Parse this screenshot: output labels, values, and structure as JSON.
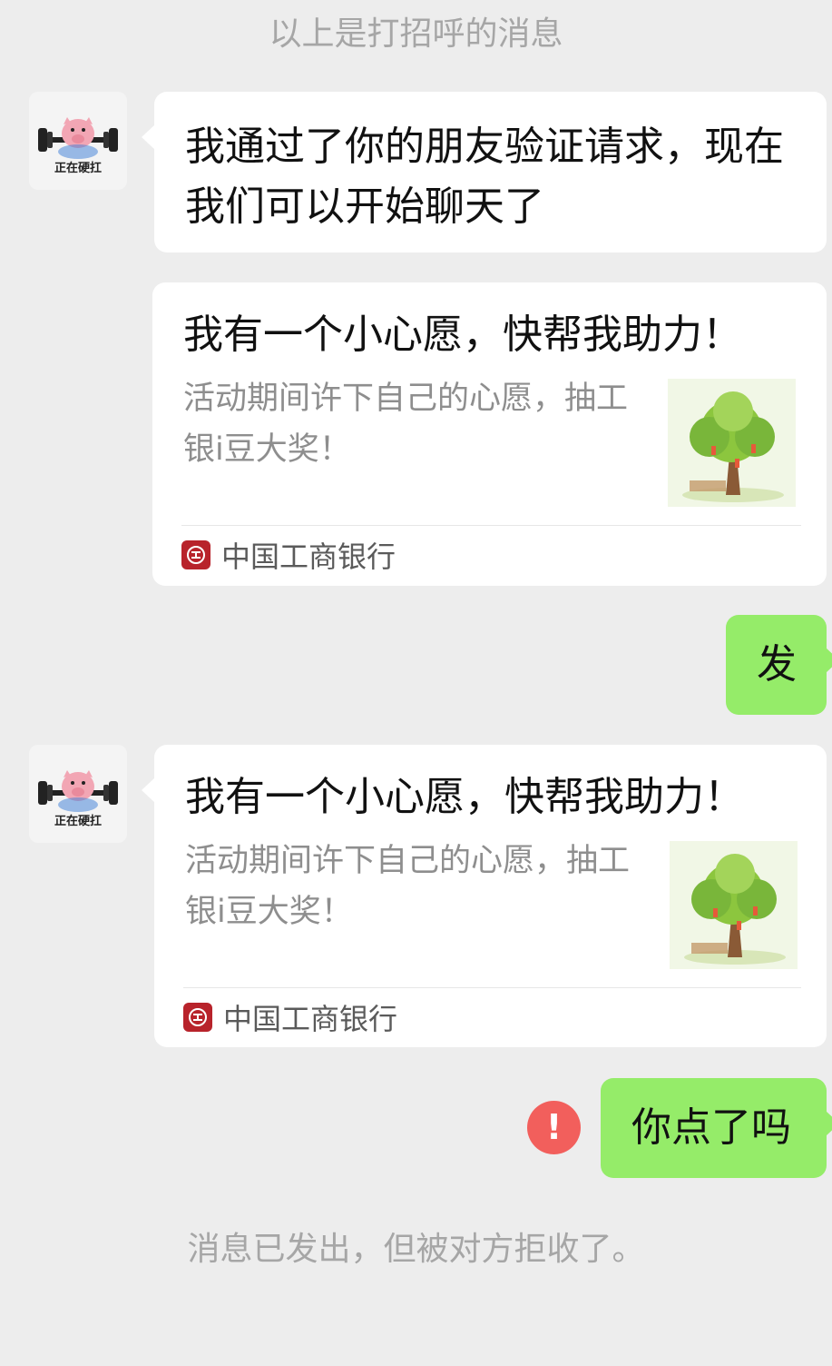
{
  "system": {
    "greeting_notice": "以上是打招呼的消息",
    "rejected_notice": "消息已发出，但被对方拒收了。"
  },
  "contact": {
    "avatar_label": "正在硬扛",
    "avatar_icon": "pig-lifting-barbell-icon"
  },
  "messages": [
    {
      "direction": "in",
      "type": "text",
      "text": "我通过了你的朋友验证请求，现在我们可以开始聊天了"
    },
    {
      "direction": "in",
      "type": "card",
      "title": "我有一个小心愿，快帮我助力！",
      "description": "活动期间许下自己的心愿，抽工银i豆大奖！",
      "thumbnail_icon": "wish-tree-icon",
      "source": "中国工商银行",
      "source_icon": "icbc-logo-icon"
    },
    {
      "direction": "out",
      "type": "text",
      "text": "发"
    },
    {
      "direction": "in",
      "type": "card",
      "title": "我有一个小心愿，快帮我助力！",
      "description": "活动期间许下自己的心愿，抽工银i豆大奖！",
      "thumbnail_icon": "wish-tree-icon",
      "source": "中国工商银行",
      "source_icon": "icbc-logo-icon"
    },
    {
      "direction": "out",
      "type": "text",
      "text": "你点了吗",
      "status": "failed",
      "status_icon": "exclamation-icon",
      "status_symbol": "!"
    }
  ],
  "colors": {
    "background": "#ededed",
    "incoming_bubble": "#ffffff",
    "outgoing_bubble": "#95ec69",
    "error_red": "#f25f5c",
    "icbc_red": "#b8232b"
  }
}
